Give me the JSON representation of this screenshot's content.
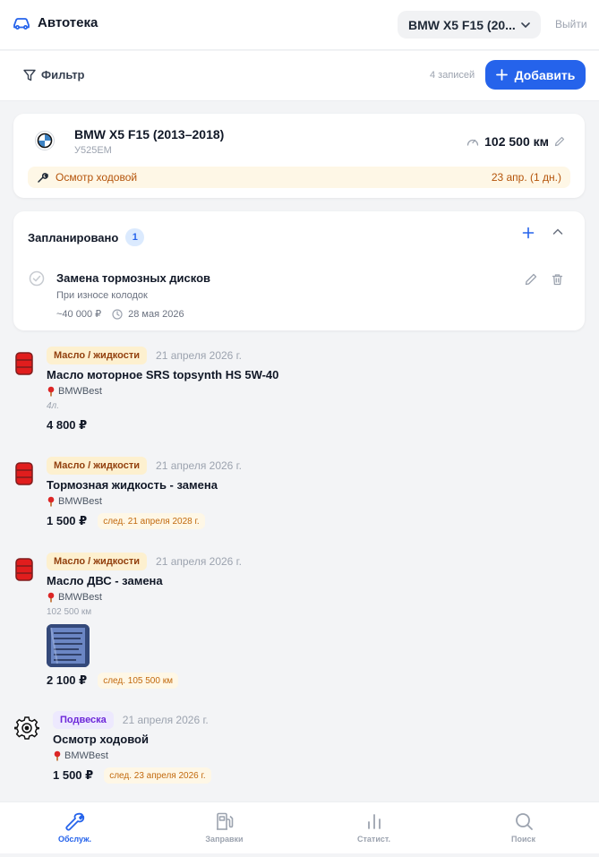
{
  "app": {
    "title": "Автотека",
    "car_selector": "BMW X5 F15 (20...",
    "logout": "Выйти"
  },
  "toolbar": {
    "filter": "Фильтр",
    "count": "4 записей",
    "add": "Добавить"
  },
  "car": {
    "name": "BMW X5 F15 (2013–2018)",
    "plate": "У525ЕМ",
    "mileage": "102 500 км",
    "reminder_text": "Осмотр ходовой",
    "reminder_due": "23 апр. (1 дн.)"
  },
  "planned": {
    "title": "Запланировано",
    "count": "1",
    "task": {
      "title": "Замена тормозных дисков",
      "subtitle": "При износе колодок",
      "cost": "~40 000 ₽",
      "date": "28 мая 2026"
    }
  },
  "entries": [
    {
      "icon": "oil-barrel-icon",
      "category": "Масло / жидкости",
      "date": "21 апреля 2026 г.",
      "title": "Масло моторное SRS topsynth HS 5W-40",
      "shop": "BMWBest",
      "note": "4л.",
      "price": "4 800 ₽"
    },
    {
      "icon": "oil-barrel-icon",
      "category": "Масло / жидкости",
      "date": "21 апреля 2026 г.",
      "title": "Тормозная жидкость - замена",
      "shop": "BMWBest",
      "price": "1 500 ₽",
      "next": "след. 21 апреля 2028 г."
    },
    {
      "icon": "oil-barrel-icon",
      "category": "Масло / жидкости",
      "date": "21 апреля 2026 г.",
      "title": "Масло ДВС - замена",
      "shop": "BMWBest",
      "km": "102 500 км",
      "price": "2 100 ₽",
      "next": "след. 105 500 км"
    },
    {
      "icon": "gear-icon",
      "category": "Подвеска",
      "date": "21 апреля 2026 г.",
      "title": "Осмотр ходовой",
      "shop": "BMWBest",
      "price": "1 500 ₽",
      "next": "след. 23 апреля 2026 г."
    }
  ],
  "nav": [
    {
      "label": "Обслуж.",
      "icon": "wrench-icon"
    },
    {
      "label": "Заправки",
      "icon": "fuel-icon"
    },
    {
      "label": "Статист.",
      "icon": "chart-icon"
    },
    {
      "label": "Поиск",
      "icon": "search-icon"
    }
  ],
  "colors": {
    "accent": "#2563eb",
    "oil_badge": "#fdf0cf",
    "suspension_badge": "#ede9fe",
    "reminder": "#fef7e6"
  }
}
